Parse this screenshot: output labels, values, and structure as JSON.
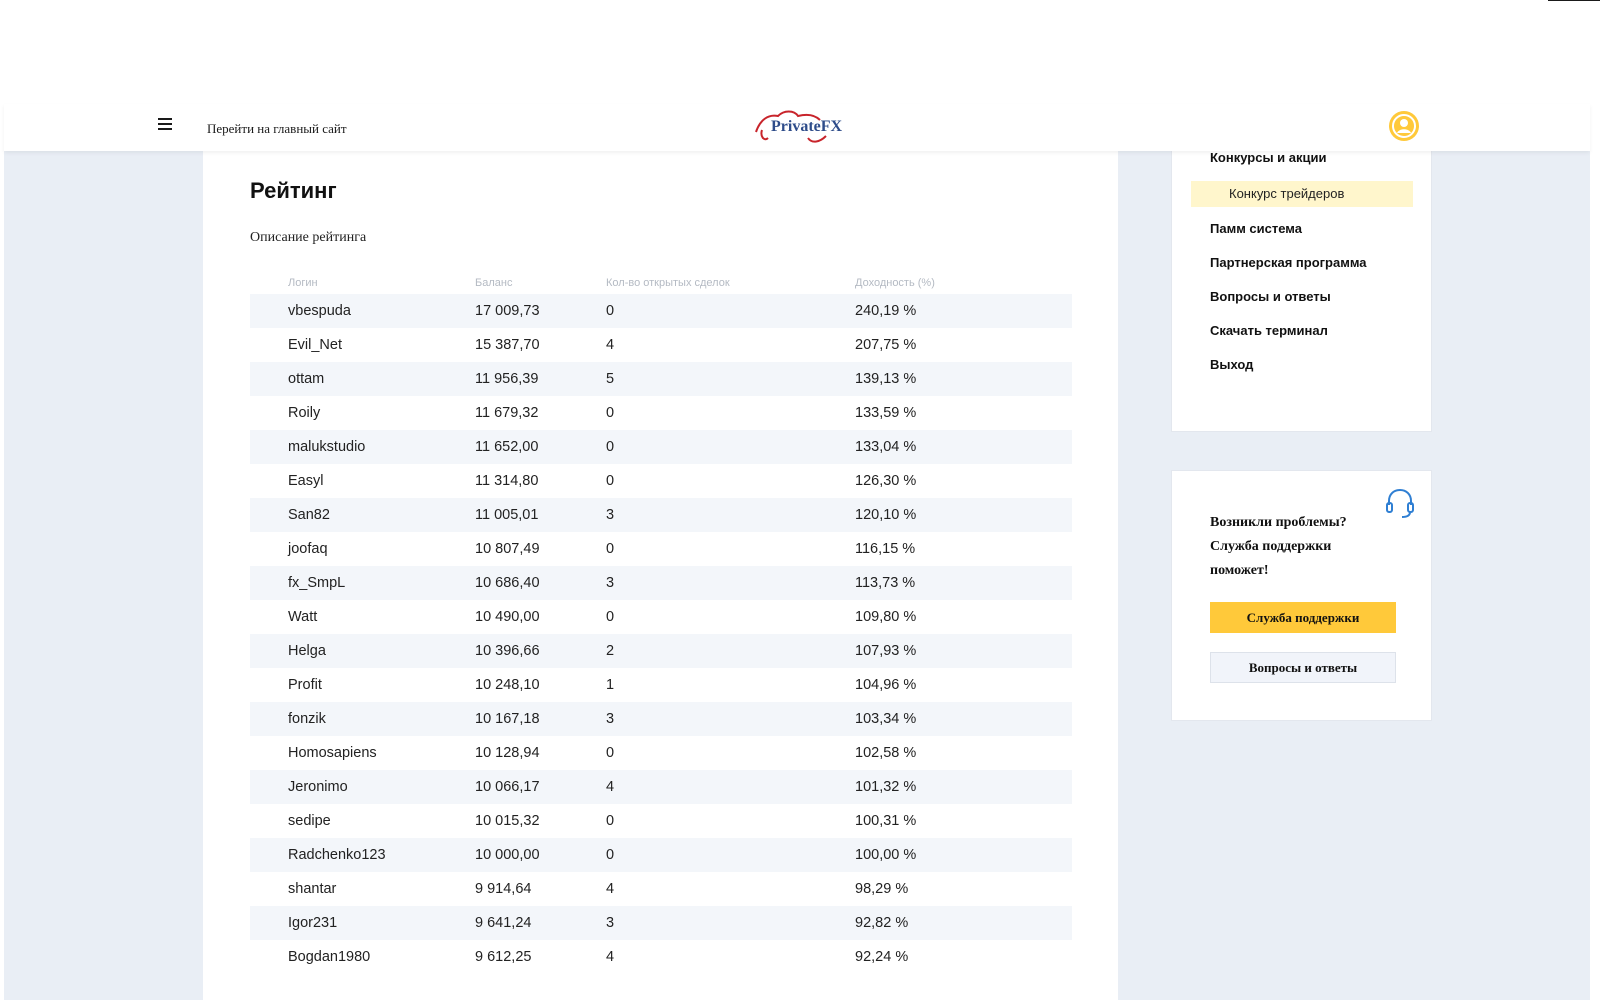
{
  "header": {
    "menu_icon": "burger-menu-icon",
    "main_site_link": "Перейти на главный сайт",
    "logo_text": "PrivateFX",
    "avatar_icon": "user-avatar-icon",
    "brand_color": "#2e4c8a",
    "accent_color": "#ffc93a"
  },
  "main": {
    "title": "Рейтинг",
    "description": "Описание рейтинга",
    "table": {
      "columns": [
        "Логин",
        "Баланс",
        "Кол-во открытых сделок",
        "Доходность (%)"
      ],
      "rows": [
        [
          "vbespuda",
          "17 009,73",
          "0",
          "240,19 %"
        ],
        [
          "Evil_Net",
          "15 387,70",
          "4",
          "207,75 %"
        ],
        [
          "ottam",
          "11 956,39",
          "5",
          "139,13 %"
        ],
        [
          "Roily",
          "11 679,32",
          "0",
          "133,59 %"
        ],
        [
          "malukstudio",
          "11 652,00",
          "0",
          "133,04 %"
        ],
        [
          "Easyl",
          "11 314,80",
          "0",
          "126,30 %"
        ],
        [
          "San82",
          "11 005,01",
          "3",
          "120,10 %"
        ],
        [
          "joofaq",
          "10 807,49",
          "0",
          "116,15 %"
        ],
        [
          "fx_SmpL",
          "10 686,40",
          "3",
          "113,73 %"
        ],
        [
          "Watt",
          "10 490,00",
          "0",
          "109,80 %"
        ],
        [
          "Helga",
          "10 396,66",
          "2",
          "107,93 %"
        ],
        [
          "Profit",
          "10 248,10",
          "1",
          "104,96 %"
        ],
        [
          "fonzik",
          "10 167,18",
          "3",
          "103,34 %"
        ],
        [
          "Homosapiens",
          "10 128,94",
          "0",
          "102,58 %"
        ],
        [
          "Jeronimo",
          "10 066,17",
          "4",
          "101,32 %"
        ],
        [
          "sedipe",
          "10 015,32",
          "0",
          "100,31 %"
        ],
        [
          "Radchenko123",
          "10 000,00",
          "0",
          "100,00 %"
        ],
        [
          "shantar",
          "9 914,64",
          "4",
          "98,29 %"
        ],
        [
          "Igor231",
          "9 641,24",
          "3",
          "92,82 %"
        ],
        [
          "Bogdan1980",
          "9 612,25",
          "4",
          "92,24 %"
        ]
      ]
    }
  },
  "sidebar": {
    "nav": [
      {
        "label": "Конкурсы и акции",
        "type": "item"
      },
      {
        "label": "Конкурс трейдеров",
        "type": "sub-active"
      },
      {
        "label": "Памм система",
        "type": "item"
      },
      {
        "label": "Партнерская программа",
        "type": "item"
      },
      {
        "label": "Вопросы и ответы",
        "type": "item"
      },
      {
        "label": "Скачать терминал",
        "type": "item"
      },
      {
        "label": "Выход",
        "type": "item"
      }
    ],
    "support": {
      "icon": "headset-icon",
      "text": "Возникли проблемы? Служба поддержки поможет!",
      "support_button": "Служба поддержки",
      "faq_button": "Вопросы и ответы"
    }
  }
}
